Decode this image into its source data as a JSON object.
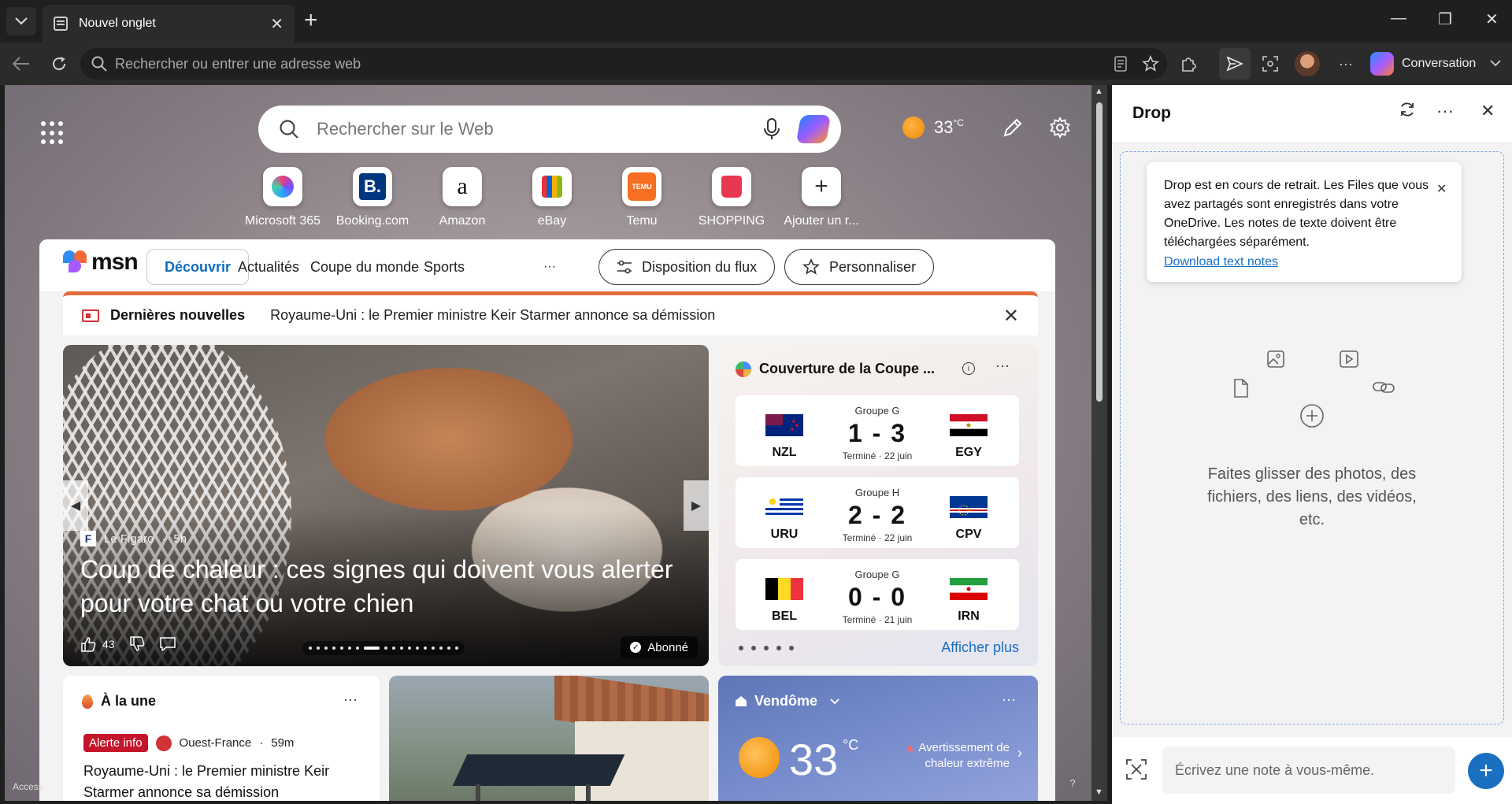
{
  "browser": {
    "tab_title": "Nouvel onglet",
    "address_placeholder": "Rechercher ou entrer une adresse web",
    "copilot_label": "Conversation"
  },
  "newtab": {
    "search_placeholder": "Rechercher sur le Web",
    "weather": {
      "temp": "33",
      "unit": "°C"
    },
    "quicklinks": [
      {
        "label": "Microsoft 365",
        "icon": "microsoft-365-icon"
      },
      {
        "label": "Booking.com",
        "icon": "booking-icon"
      },
      {
        "label": "Amazon",
        "icon": "amazon-icon"
      },
      {
        "label": "eBay",
        "icon": "ebay-icon"
      },
      {
        "label": "Temu",
        "icon": "temu-icon"
      },
      {
        "label": "SHOPPING",
        "icon": "shopping-icon"
      },
      {
        "label": "Ajouter un r...",
        "icon": "plus-icon"
      }
    ],
    "access_label": "Access"
  },
  "feed": {
    "logo": "msn",
    "nav": [
      "Découvrir",
      "Actualités",
      "Coupe du monde",
      "Sports"
    ],
    "layout_button": "Disposition du flux",
    "personalize_button": "Personnaliser",
    "breaking": {
      "label": "Dernières nouvelles",
      "text": "Royaume-Uni : le Premier ministre Keir Starmer annonce sa démission"
    },
    "hero": {
      "source": "Le Figaro",
      "source_logo": "F",
      "age": "5h",
      "headline": "Coup de chaleur : ces signes qui doivent vous alerter pour votre chat ou votre chien",
      "likes": "43",
      "subscribed": "Abonné"
    },
    "worldcup": {
      "title": "Couverture de la Coupe ...",
      "matches": [
        {
          "group": "Groupe G",
          "home": "NZL",
          "away": "EGY",
          "score": "1 - 3",
          "status": "Terminé · 22 juin"
        },
        {
          "group": "Groupe H",
          "home": "URU",
          "away": "CPV",
          "score": "2 - 2",
          "status": "Terminé · 22 juin"
        },
        {
          "group": "Groupe G",
          "home": "BEL",
          "away": "IRN",
          "score": "0 - 0",
          "status": "Terminé · 21 juin"
        }
      ],
      "see_more": "Afficher plus"
    },
    "top_stories": {
      "title": "À la une",
      "badge": "Alerte info",
      "source": "Ouest-France",
      "age": "59m",
      "headline": "Royaume-Uni : le Premier ministre Keir Starmer annonce sa démission"
    },
    "weather_card": {
      "location": "Vendôme",
      "temp": "33",
      "unit": "°C",
      "alert": "Avertissement de chaleur extrême"
    }
  },
  "drop": {
    "title": "Drop",
    "notice": "Drop est en cours de retrait. Les Files que vous avez partagés sont enregistrés dans votre OneDrive. Les notes de texte doivent être téléchargées séparément.",
    "notice_link": "Download text notes",
    "hint": "Faites glisser des photos, des fichiers, des liens, des vidéos, etc.",
    "note_placeholder": "Écrivez une note à vous-même."
  }
}
